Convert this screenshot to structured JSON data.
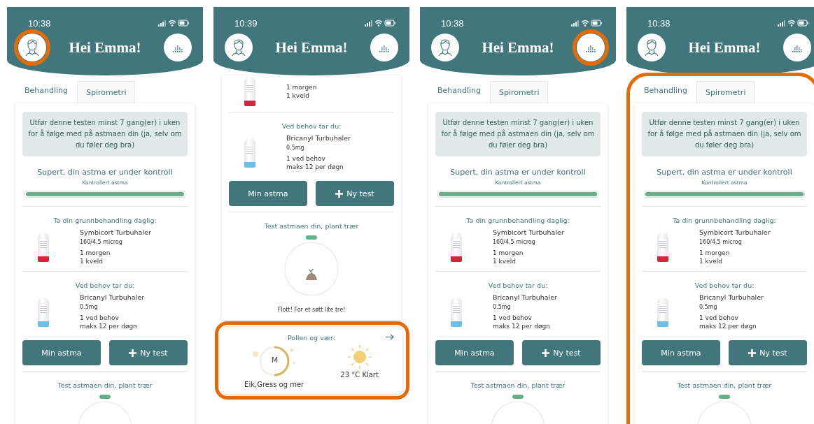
{
  "screens": [
    {
      "time": "10:38",
      "greeting": "Hei Emma!",
      "profile_highlighted": true,
      "statistics_highlighted": false,
      "content_highlighted": false,
      "tabs": [
        {
          "label": "Behandling",
          "selected": true
        },
        {
          "label": "Spirometri",
          "selected": false
        }
      ],
      "notice": "Utfør denne testen minst 7 gang(er) i uken for å følge med på astmaen din (ja, selv om du føler deg bra)",
      "status": {
        "title": "Supert, din astma er under kontroll",
        "subtitle": "Kontrollert astma",
        "level": 1
      },
      "sections": [
        {
          "heading": "Ta din grunnbehandling daglig:",
          "meds": [
            {
              "kind": "symbicort",
              "name": "Symbicort Turbuhaler",
              "strength": "160/4,5 microg",
              "dosage": [
                "1 morgen",
                "1 kveld"
              ]
            }
          ]
        },
        {
          "heading": "Ved behov tar du:",
          "meds": [
            {
              "kind": "bricanyl",
              "name": "Bricanyl Turbuhaler",
              "strength": "0.5mg",
              "dosage": [
                "1 ved behov",
                "maks 12 per døgn"
              ]
            }
          ]
        }
      ],
      "buttons": [
        {
          "kind": "plain",
          "label": "Min astma"
        },
        {
          "kind": "add",
          "label": "Ny test"
        }
      ],
      "link": "Test astmaen din, plant trær"
    },
    {
      "time": "10:39",
      "greeting": "Hei Emma!",
      "profile_highlighted": false,
      "statistics_highlighted": false,
      "content_highlighted": false,
      "sections": [
        {
          "meds": [
            {
              "kind": "symbicort",
              "dosage": [
                "1 morgen",
                "1 kveld"
              ]
            }
          ]
        },
        {
          "heading": "Ved behov tar du:",
          "meds": [
            {
              "kind": "bricanyl",
              "name": "Bricanyl Turbuhaler",
              "strength": "0.5mg",
              "dosage": [
                "1 ved behov",
                "maks 12 per døgn"
              ]
            }
          ]
        }
      ],
      "buttons": [
        {
          "kind": "plain",
          "label": "Min astma"
        },
        {
          "kind": "add",
          "label": "Ny test"
        }
      ],
      "link": "Test astmaen din, plant trær",
      "tree_caption": "Flott! For et søtt lite tre!",
      "pollen": {
        "highlighted": true,
        "title": "Pollen og vær:",
        "gauge_letter": "M",
        "level": 0.5,
        "pollen_label": "Eik,Gress og mer",
        "weather": "23 °C Klart"
      }
    },
    {
      "time": "10:38",
      "greeting": "Hei Emma!",
      "profile_highlighted": false,
      "statistics_highlighted": true,
      "content_highlighted": false,
      "tabs": [
        {
          "label": "Behandling",
          "selected": true
        },
        {
          "label": "Spirometri",
          "selected": false
        }
      ],
      "notice": "Utfør denne testen minst 7 gang(er) i uken for å følge med på astmaen din (ja, selv om du føler deg bra)",
      "status": {
        "title": "Supert, din astma er under kontroll",
        "subtitle": "Kontrollert astma",
        "level": 1
      },
      "sections": [
        {
          "heading": "Ta din grunnbehandling daglig:",
          "meds": [
            {
              "kind": "symbicort",
              "name": "Symbicort Turbuhaler",
              "strength": "160/4,5 microg",
              "dosage": [
                "1 morgen",
                "1 kveld"
              ]
            }
          ]
        },
        {
          "heading": "Ved behov tar du:",
          "meds": [
            {
              "kind": "bricanyl",
              "name": "Bricanyl Turbuhaler",
              "strength": "0.5mg",
              "dosage": [
                "1 ved behov",
                "maks 12 per døgn"
              ]
            }
          ]
        }
      ],
      "buttons": [
        {
          "kind": "plain",
          "label": "Min astma"
        },
        {
          "kind": "add",
          "label": "Ny test"
        }
      ],
      "link": "Test astmaen din, plant trær"
    },
    {
      "time": "10:38",
      "greeting": "Hei Emma!",
      "profile_highlighted": false,
      "statistics_highlighted": false,
      "content_highlighted": true,
      "tabs": [
        {
          "label": "Behandling",
          "selected": true
        },
        {
          "label": "Spirometri",
          "selected": false
        }
      ],
      "notice": "Utfør denne testen minst 7 gang(er) i uken for å følge med på astmaen din (ja, selv om du føler deg bra)",
      "status": {
        "title": "Supert, din astma er under kontroll",
        "subtitle": "Kontrollert astma",
        "level": 1
      },
      "sections": [
        {
          "heading": "Ta din grunnbehandling daglig:",
          "meds": [
            {
              "kind": "symbicort",
              "name": "Symbicort Turbuhaler",
              "strength": "160/4,5 microg",
              "dosage": [
                "1 morgen",
                "1 kveld"
              ]
            }
          ]
        },
        {
          "heading": "Ved behov tar du:",
          "meds": [
            {
              "kind": "bricanyl",
              "name": "Bricanyl Turbuhaler",
              "strength": "0.5mg",
              "dosage": [
                "1 ved behov",
                "maks 12 per døgn"
              ]
            }
          ]
        }
      ],
      "buttons": [
        {
          "kind": "plain",
          "label": "Min astma"
        },
        {
          "kind": "add",
          "label": "Ny test"
        }
      ],
      "link": "Test astmaen din, plant trær"
    }
  ]
}
